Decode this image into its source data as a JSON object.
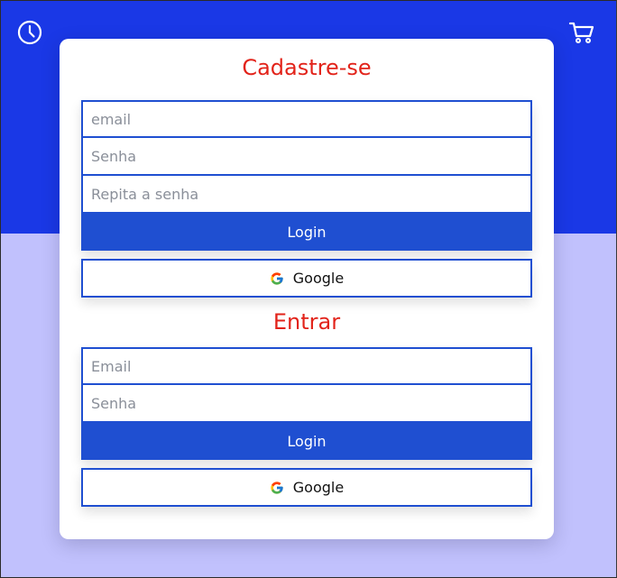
{
  "header": {
    "history_icon": "clock-icon",
    "cart_icon": "cart-icon"
  },
  "signup": {
    "title": "Cadastre-se",
    "email_placeholder": "email",
    "password_placeholder": "Senha",
    "repeat_password_placeholder": "Repita a senha",
    "submit_label": "Login",
    "google_label": "Google"
  },
  "signin": {
    "title": "Entrar",
    "email_placeholder": "Email",
    "password_placeholder": "Senha",
    "submit_label": "Login",
    "google_label": "Google"
  },
  "colors": {
    "header_blue": "#1a38e6",
    "background_lavender": "#c1c1fd",
    "primary_button": "#1f4fd1",
    "title_red": "#e2231a"
  }
}
